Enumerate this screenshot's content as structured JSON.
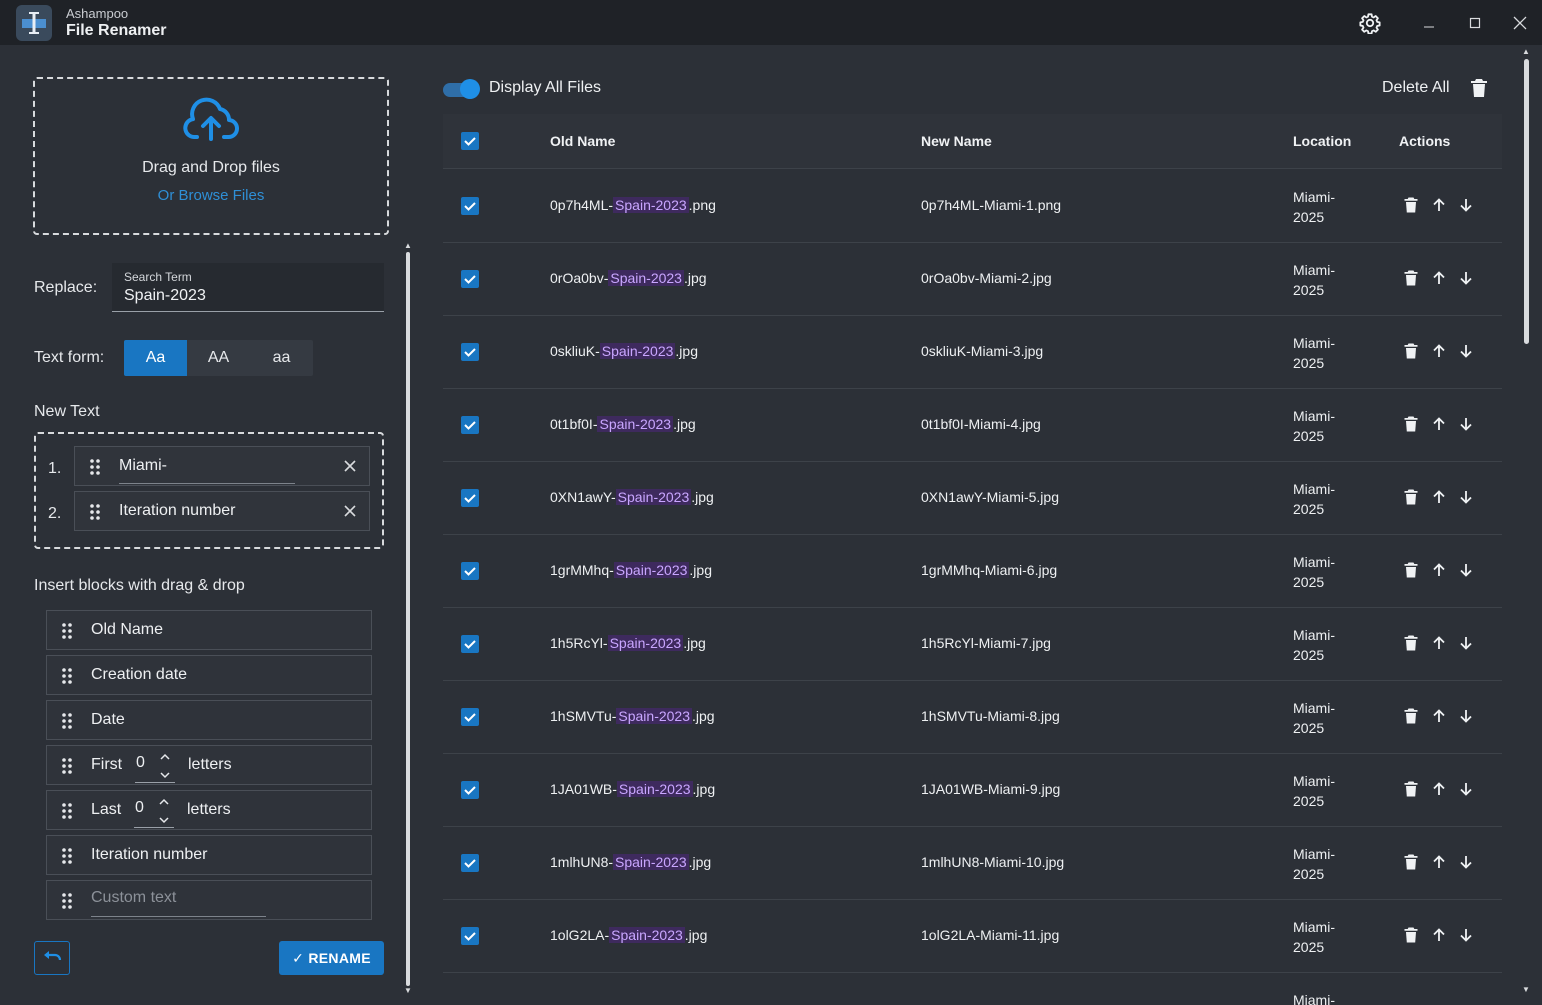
{
  "titlebar": {
    "brand": "Ashampoo",
    "app_name": "File Renamer"
  },
  "dropzone": {
    "title": "Drag and Drop files",
    "browse_link": "Or Browse Files"
  },
  "replace": {
    "label": "Replace:",
    "caption": "Search Term",
    "value": "Spain-2023"
  },
  "text_form": {
    "label": "Text form:",
    "options": [
      "Aa",
      "AA",
      "aa"
    ],
    "selected": "Aa"
  },
  "new_text": {
    "label": "New Text",
    "items": [
      {
        "index": "1.",
        "text": "Miami-"
      },
      {
        "index": "2.",
        "text": "Iteration number"
      }
    ]
  },
  "insert_blocks": {
    "label": "Insert blocks with drag & drop",
    "old_name": "Old Name",
    "creation_date": "Creation date",
    "date": "Date",
    "first_prefix": "First",
    "first_value": "0",
    "first_suffix": "letters",
    "last_prefix": "Last",
    "last_value": "0",
    "last_suffix": "letters",
    "iteration_number": "Iteration number",
    "custom_text_placeholder": "Custom text"
  },
  "actions": {
    "rename": "✓ RENAME"
  },
  "toolbar": {
    "display_all": "Display All Files",
    "display_all_on": true,
    "delete_all": "Delete All"
  },
  "table": {
    "columns": [
      "Old Name",
      "New Name",
      "Location",
      "Actions"
    ],
    "rows": [
      {
        "old_prefix": "0p7h4ML-",
        "old_match": "Spain-2023",
        "old_suffix": ".png",
        "new_name": "0p7h4ML-Miami-1.png",
        "location_1": "Miami-",
        "location_2": "2025"
      },
      {
        "old_prefix": "0rOa0bv-",
        "old_match": "Spain-2023",
        "old_suffix": ".jpg",
        "new_name": "0rOa0bv-Miami-2.jpg",
        "location_1": "Miami-",
        "location_2": "2025"
      },
      {
        "old_prefix": "0skliuK-",
        "old_match": "Spain-2023",
        "old_suffix": ".jpg",
        "new_name": "0skliuK-Miami-3.jpg",
        "location_1": "Miami-",
        "location_2": "2025"
      },
      {
        "old_prefix": "0t1bf0I-",
        "old_match": "Spain-2023",
        "old_suffix": ".jpg",
        "new_name": "0t1bf0I-Miami-4.jpg",
        "location_1": "Miami-",
        "location_2": "2025"
      },
      {
        "old_prefix": "0XN1awY-",
        "old_match": "Spain-2023",
        "old_suffix": ".jpg",
        "new_name": "0XN1awY-Miami-5.jpg",
        "location_1": "Miami-",
        "location_2": "2025"
      },
      {
        "old_prefix": "1grMMhq-",
        "old_match": "Spain-2023",
        "old_suffix": ".jpg",
        "new_name": "1grMMhq-Miami-6.jpg",
        "location_1": "Miami-",
        "location_2": "2025"
      },
      {
        "old_prefix": "1h5RcYl-",
        "old_match": "Spain-2023",
        "old_suffix": ".jpg",
        "new_name": "1h5RcYl-Miami-7.jpg",
        "location_1": "Miami-",
        "location_2": "2025"
      },
      {
        "old_prefix": "1hSMVTu-",
        "old_match": "Spain-2023",
        "old_suffix": ".jpg",
        "new_name": "1hSMVTu-Miami-8.jpg",
        "location_1": "Miami-",
        "location_2": "2025"
      },
      {
        "old_prefix": "1JA01WB-",
        "old_match": "Spain-2023",
        "old_suffix": ".jpg",
        "new_name": "1JA01WB-Miami-9.jpg",
        "location_1": "Miami-",
        "location_2": "2025"
      },
      {
        "old_prefix": "1mlhUN8-",
        "old_match": "Spain-2023",
        "old_suffix": ".jpg",
        "new_name": "1mlhUN8-Miami-10.jpg",
        "location_1": "Miami-",
        "location_2": "2025"
      },
      {
        "old_prefix": "1olG2LA-",
        "old_match": "Spain-2023",
        "old_suffix": ".jpg",
        "new_name": "1olG2LA-Miami-11.jpg",
        "location_1": "Miami-",
        "location_2": "2025"
      },
      {
        "old_prefix": "",
        "old_match": "",
        "old_suffix": "",
        "new_name": "",
        "location_1": "Miami-",
        "location_2": ""
      }
    ]
  },
  "colors": {
    "accent": "#1976c2",
    "highlight_bg": "#3e2a5e",
    "highlight_fg": "#c9a6ff",
    "background": "#2c3037",
    "titlebar": "#1f2227"
  },
  "icons": {
    "settings": "gear-icon",
    "minimize": "minimize-icon",
    "maximize": "maximize-icon",
    "close": "close-icon",
    "upload": "cloud-upload-icon",
    "drag": "drag-handle-icon",
    "remove": "close-icon",
    "delete": "trash-icon",
    "move_up": "arrow-up-icon",
    "move_down": "arrow-down-icon",
    "undo": "undo-icon"
  }
}
